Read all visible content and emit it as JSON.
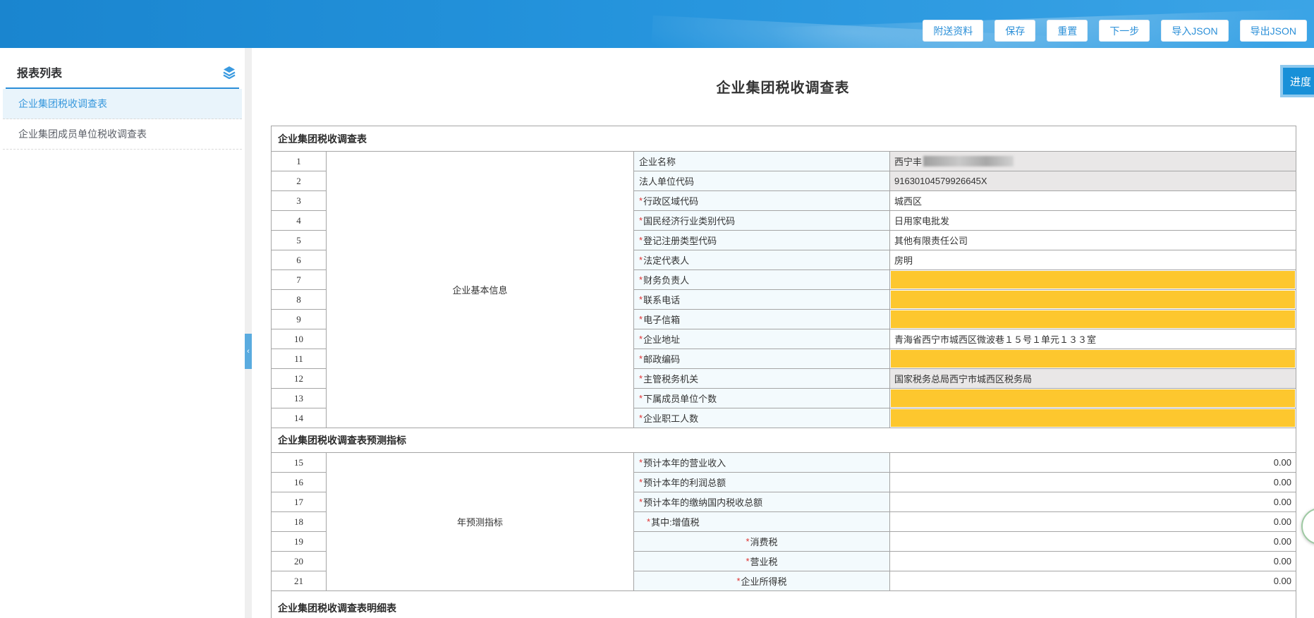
{
  "topbar": {
    "buttons": [
      {
        "id": "attachments-button",
        "label": "附送资料"
      },
      {
        "id": "save-button",
        "label": "保存"
      },
      {
        "id": "reset-button",
        "label": "重置"
      },
      {
        "id": "next-step-button",
        "label": "下一步"
      },
      {
        "id": "import-json-button",
        "label": "导入JSON"
      },
      {
        "id": "export-json-button",
        "label": "导出JSON"
      }
    ]
  },
  "sidebar": {
    "title": "报表列表",
    "items": [
      {
        "label": "企业集团税收调查表",
        "active": true
      },
      {
        "label": "企业集团成员单位税收调查表",
        "active": false
      }
    ]
  },
  "collapse": {
    "chevron": "‹"
  },
  "main": {
    "title": "企业集团税收调查表",
    "progress_button": "进度"
  },
  "form": {
    "sections": [
      {
        "header": "企业集团税收调查表",
        "group": "企业基本信息",
        "rows": [
          {
            "num": "1",
            "required": false,
            "label": "企业名称",
            "value": "西宁丰",
            "redacted": true,
            "field": "readonly"
          },
          {
            "num": "2",
            "required": false,
            "label": "法人单位代码",
            "value": "91630104579926645X",
            "field": "readonly"
          },
          {
            "num": "3",
            "required": true,
            "label": "行政区域代码",
            "value": "城西区",
            "field": "input"
          },
          {
            "num": "4",
            "required": true,
            "label": "国民经济行业类别代码",
            "value": "日用家电批发",
            "field": "input"
          },
          {
            "num": "5",
            "required": true,
            "label": "登记注册类型代码",
            "value": "其他有限责任公司",
            "field": "input"
          },
          {
            "num": "6",
            "required": true,
            "label": "法定代表人",
            "value": "房明",
            "field": "input"
          },
          {
            "num": "7",
            "required": true,
            "label": "财务负责人",
            "value": "",
            "field": "required-empty"
          },
          {
            "num": "8",
            "required": true,
            "label": "联系电话",
            "value": "",
            "field": "required-empty"
          },
          {
            "num": "9",
            "required": true,
            "label": "电子信箱",
            "value": "",
            "field": "required-empty"
          },
          {
            "num": "10",
            "required": true,
            "label": "企业地址",
            "value": "青海省西宁市城西区微波巷１５号１单元１３３室",
            "field": "input"
          },
          {
            "num": "11",
            "required": true,
            "label": "邮政编码",
            "value": "",
            "field": "required-empty"
          },
          {
            "num": "12",
            "required": true,
            "label": "主管税务机关",
            "value": "国家税务总局西宁市城西区税务局",
            "field": "readonly"
          },
          {
            "num": "13",
            "required": true,
            "label": "下属成员单位个数",
            "value": "",
            "field": "required-empty"
          },
          {
            "num": "14",
            "required": true,
            "label": "企业职工人数",
            "value": "",
            "field": "required-empty"
          }
        ]
      },
      {
        "header": "企业集团税收调查表预测指标",
        "group": "年预测指标",
        "rows": [
          {
            "num": "15",
            "required": true,
            "label": "预计本年的营业收入",
            "value": "0.00",
            "field": "number"
          },
          {
            "num": "16",
            "required": true,
            "label": "预计本年的利润总额",
            "value": "0.00",
            "field": "number"
          },
          {
            "num": "17",
            "required": true,
            "label": "预计本年的缴纳国内税收总额",
            "value": "0.00",
            "field": "number"
          },
          {
            "num": "18",
            "required": true,
            "label": "其中:增值税",
            "value": "0.00",
            "field": "number",
            "label_align": "indent"
          },
          {
            "num": "19",
            "required": true,
            "label": "消费税",
            "value": "0.00",
            "field": "number",
            "label_align": "center"
          },
          {
            "num": "20",
            "required": true,
            "label": "营业税",
            "value": "0.00",
            "field": "number",
            "label_align": "center"
          },
          {
            "num": "21",
            "required": true,
            "label": "企业所得税",
            "value": "0.00",
            "field": "number",
            "label_align": "center"
          }
        ]
      },
      {
        "header": "企业集团税收调查表明细表",
        "rows": []
      }
    ]
  },
  "colors": {
    "topbar_blue": "#2493dc",
    "accent_blue": "#2b8ed8",
    "button_text_blue": "#2a8fd8",
    "sidebar_selected_bg": "#e9f4fb",
    "sidebar_selected_text": "#3697dc",
    "required_empty_yellow": "#fdc72e",
    "readonly_gray": "#e9e7e7",
    "label_cell_bg": "#f3fafd",
    "asterisk_red": "#e03030",
    "table_border": "#a5a5a5",
    "progress_button_bg": "#1890d8",
    "progress_button_border": "#8fc9ee",
    "collapse_tab_blue": "#5aabdf"
  }
}
